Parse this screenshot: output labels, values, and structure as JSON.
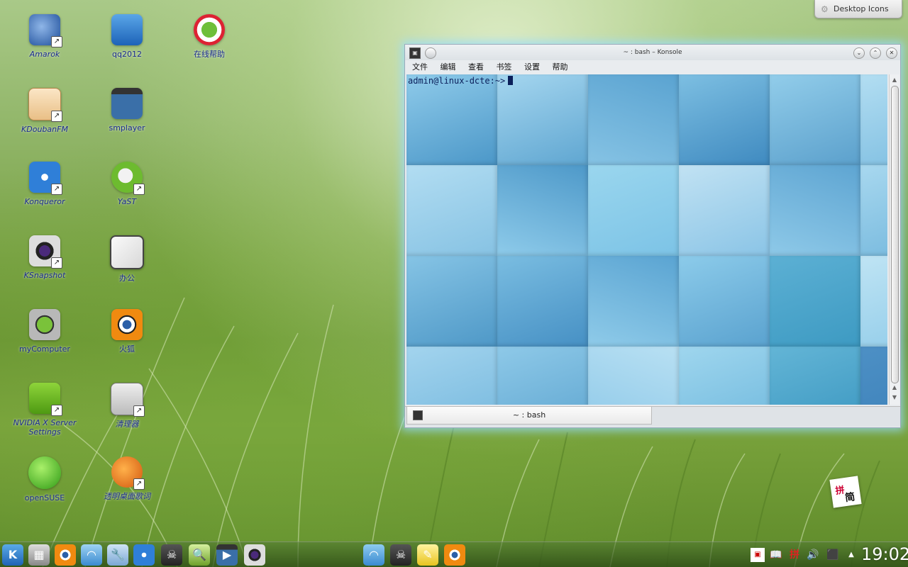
{
  "desktop": {
    "icons": [
      {
        "label": "Amarok",
        "italic": true
      },
      {
        "label": "qq2012",
        "italic": false
      },
      {
        "label": "在线帮助",
        "italic": false
      },
      {
        "label": "KDoubanFM",
        "italic": true
      },
      {
        "label": "smplayer",
        "italic": false
      },
      {
        "label": "Konqueror",
        "italic": true
      },
      {
        "label": "YaST",
        "italic": true
      },
      {
        "label": "KSnapshot",
        "italic": true
      },
      {
        "label": "办公",
        "italic": false
      },
      {
        "label": "myComputer",
        "italic": false
      },
      {
        "label": "火狐",
        "italic": false
      },
      {
        "label": "NVIDIA X Server Settings",
        "italic": true
      },
      {
        "label": "清理器",
        "italic": true
      },
      {
        "label": "openSUSE",
        "italic": false
      },
      {
        "label": "透明桌面歌词",
        "italic": true
      }
    ],
    "desktop_icons_tab": "Desktop Icons"
  },
  "konsole": {
    "title": "~ : bash – Konsole",
    "menu": [
      "文件",
      "编辑",
      "查看",
      "书签",
      "设置",
      "帮助"
    ],
    "prompt": "admin@linux-dcte:~>",
    "tab_label": "~ : bash"
  },
  "ime": {
    "glyph_top": "拼",
    "glyph_bottom": "简"
  },
  "taskbar": {
    "tray_ime": "拼",
    "clock": "19:02"
  },
  "colors": {
    "label_text": "#1b2c8f",
    "window_glow": "#96dcff",
    "terminal_text": "#0b1f5a"
  }
}
